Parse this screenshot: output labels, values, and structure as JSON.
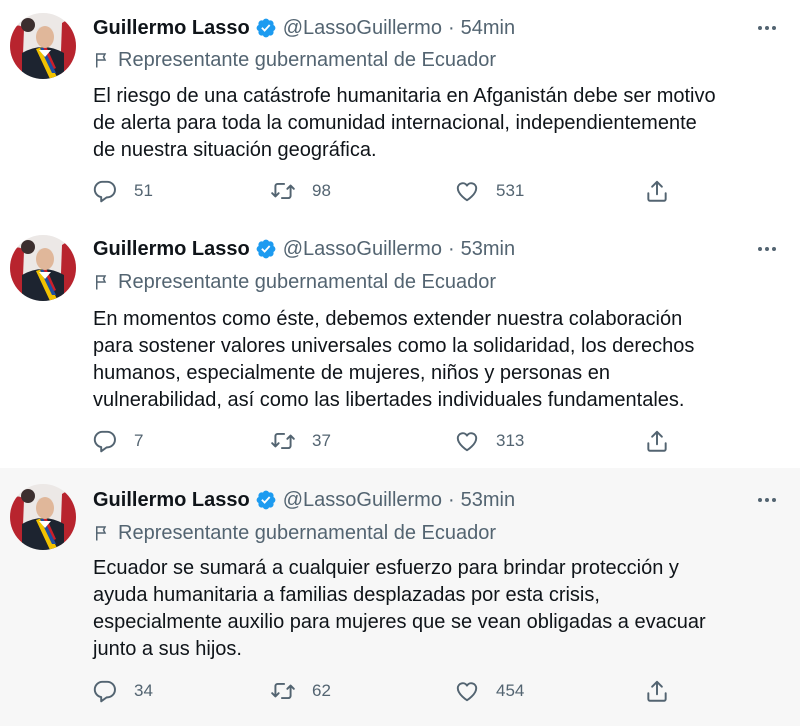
{
  "tweets": [
    {
      "name": "Guillermo Lasso",
      "handle": "@LassoGuillermo",
      "separator": "·",
      "time": "54min",
      "label": "Representante gubernamental de Ecuador",
      "lines": [
        "El riesgo de una catástrofe humanitaria en Afganistán debe ser motivo",
        "de alerta para toda la comunidad internacional, independientemente",
        "de nuestra situación geográfica."
      ],
      "replies": "51",
      "retweets": "98",
      "likes": "531"
    },
    {
      "name": "Guillermo Lasso",
      "handle": "@LassoGuillermo",
      "separator": "·",
      "time": "53min",
      "label": "Representante gubernamental de Ecuador",
      "lines": [
        "En momentos como éste, debemos extender nuestra colaboración",
        "para sostener valores universales como la solidaridad, los derechos",
        "humanos, especialmente de mujeres, niños y personas en",
        "vulnerabilidad, así como las libertades individuales fundamentales."
      ],
      "replies": "7",
      "retweets": "37",
      "likes": "313"
    },
    {
      "name": "Guillermo Lasso",
      "handle": "@LassoGuillermo",
      "separator": "·",
      "time": "53min",
      "label": "Representante gubernamental de Ecuador",
      "lines": [
        "Ecuador se sumará a cualquier esfuerzo para brindar protección y",
        "ayuda humanitaria a familias desplazadas por esta crisis,",
        "especialmente auxilio para mujeres que se vean obligadas a evacuar",
        "junto a sus hijos."
      ],
      "replies": "34",
      "retweets": "62",
      "likes": "454"
    }
  ],
  "icons": {
    "verified": "verified-badge-icon",
    "label": "flag-icon",
    "more": "more-icon",
    "reply": "reply-icon",
    "retweet": "retweet-icon",
    "like": "heart-icon",
    "share": "share-icon"
  },
  "colors": {
    "verified": "#1d9bf0",
    "secondary_text": "#536471",
    "primary_text": "#0f1419",
    "thread_line": "#cfd9de",
    "highlight_bg": "#f7f7f7"
  }
}
